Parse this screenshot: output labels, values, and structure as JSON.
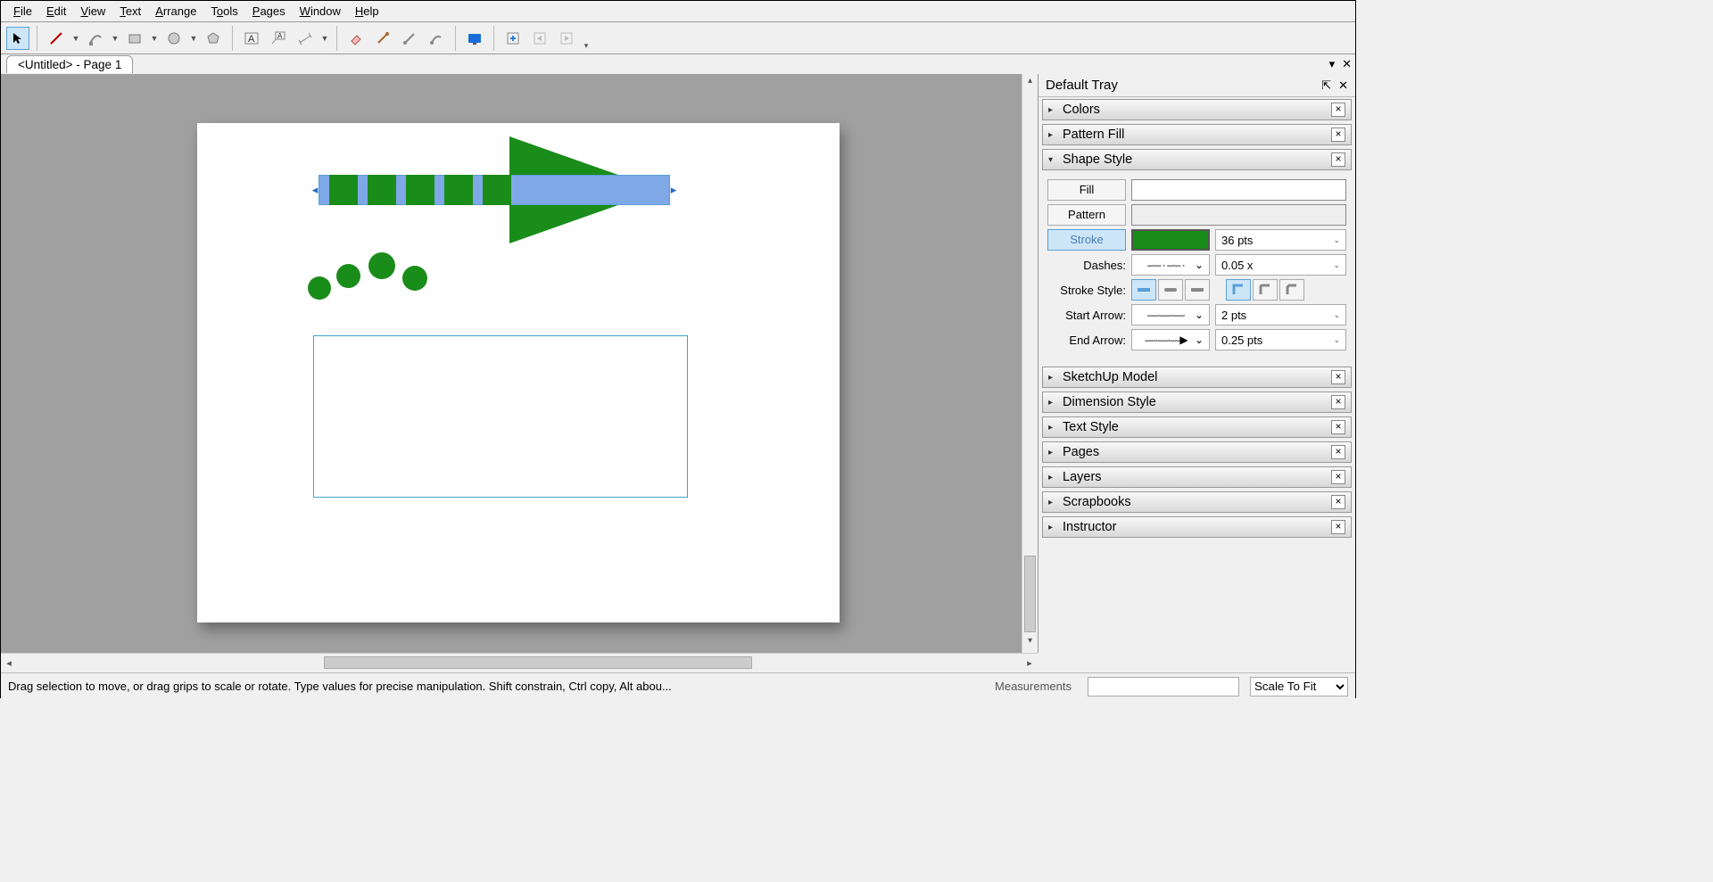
{
  "menu": {
    "file": "File",
    "edit": "Edit",
    "view": "View",
    "text": "Text",
    "arrange": "Arrange",
    "tools": "Tools",
    "pages": "Pages",
    "window": "Window",
    "help": "Help"
  },
  "tab": {
    "title": "<Untitled> - Page 1"
  },
  "tray": {
    "title": "Default Tray",
    "panels": {
      "colors": "Colors",
      "pattern_fill": "Pattern Fill",
      "shape_style": "Shape Style",
      "sketchup": "SketchUp Model",
      "dimension": "Dimension Style",
      "text_style": "Text Style",
      "pages": "Pages",
      "layers": "Layers",
      "scrapbooks": "Scrapbooks",
      "instructor": "Instructor"
    },
    "shape_style": {
      "fill": "Fill",
      "pattern": "Pattern",
      "stroke": "Stroke",
      "stroke_size": "36 pts",
      "dashes": "Dashes:",
      "dashes_val": "0.05 x",
      "stroke_style": "Stroke Style:",
      "start_arrow": "Start Arrow:",
      "start_arrow_val": "2 pts",
      "end_arrow": "End Arrow:",
      "end_arrow_val": "0.25 pts"
    }
  },
  "status": {
    "hint": "Drag selection to move, or drag grips to scale or rotate. Type values for precise manipulation. Shift constrain, Ctrl copy, Alt abou...",
    "measurements": "Measurements",
    "zoom": "Scale To Fit"
  }
}
